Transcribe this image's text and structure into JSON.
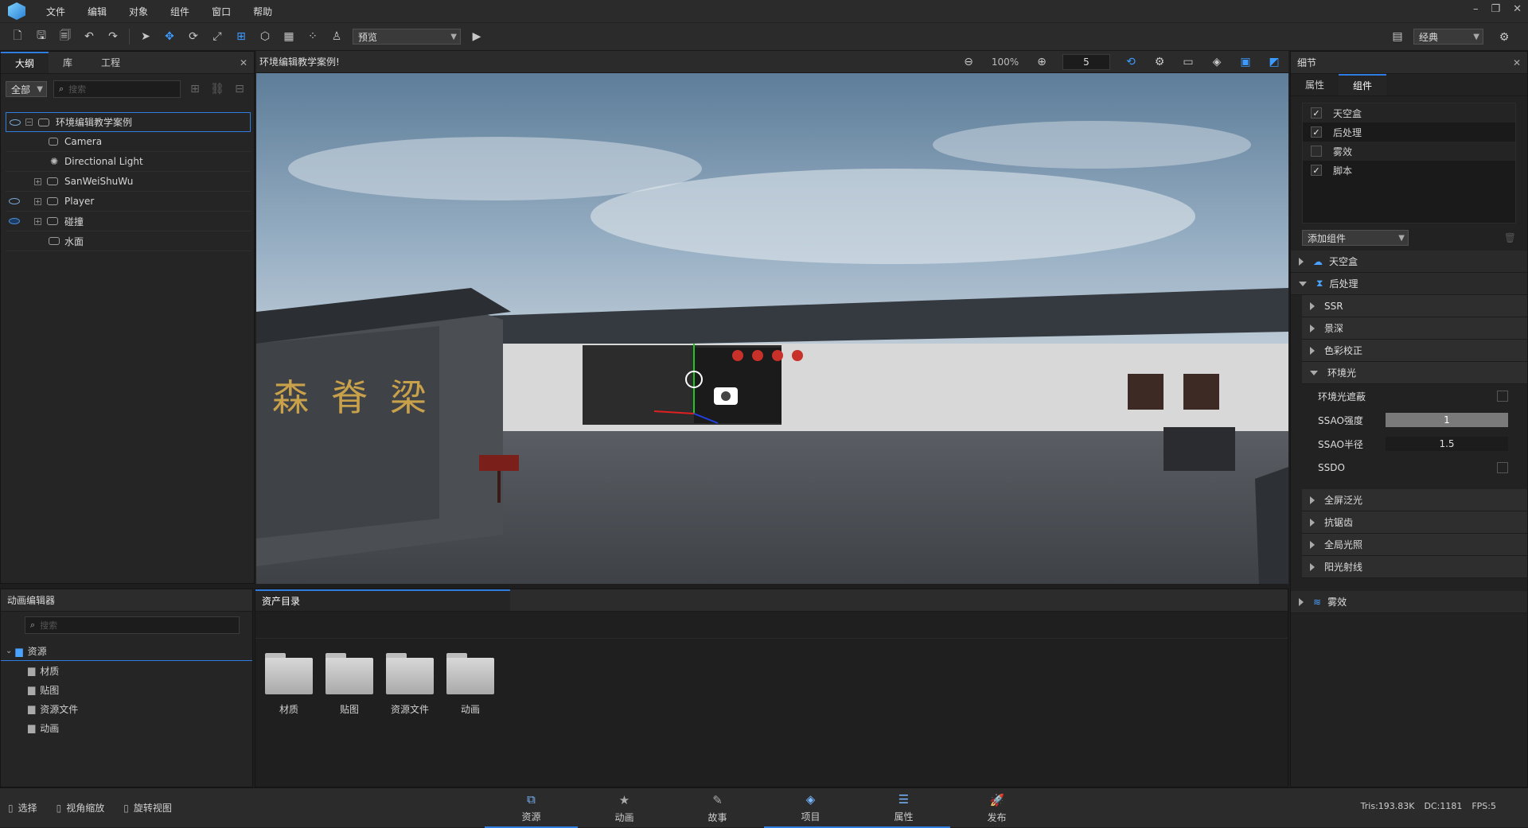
{
  "menu": [
    "文件",
    "编辑",
    "对象",
    "组件",
    "窗口",
    "帮助"
  ],
  "toolbar": {
    "preview_combo": "预览",
    "layout_combo": "经典"
  },
  "outline": {
    "tabs": [
      "大纲",
      "库",
      "工程"
    ],
    "filter": "全部",
    "search_placeholder": "搜索",
    "nodes": [
      "环境编辑教学案例",
      "Camera",
      "Directional Light",
      "SanWeiShuWu",
      "Player",
      "碰撞",
      "水面"
    ]
  },
  "viewport": {
    "title": "环境编辑教学案例!",
    "zoom": "100%",
    "speed": "5",
    "wall_text": "森脊梁"
  },
  "details": {
    "title": "细节",
    "tabs": [
      "属性",
      "组件"
    ],
    "components": [
      {
        "label": "天空盒",
        "checked": "✓"
      },
      {
        "label": "后处理",
        "checked": "✓"
      },
      {
        "label": "雾效",
        "checked": ""
      },
      {
        "label": "脚本",
        "checked": "✓"
      }
    ],
    "add_component": "添加组件",
    "sections": {
      "skybox": "天空盒",
      "postprocess": "后处理",
      "ssr": "SSR",
      "dof": "景深",
      "color": "色彩校正",
      "ambient": "环境光",
      "ao": "环境光遮蔽",
      "ssao_strength_label": "SSAO强度",
      "ssao_strength": "1",
      "ssao_radius_label": "SSAO半径",
      "ssao_radius": "1.5",
      "ssdo": "SSDO",
      "bloom": "全屏泛光",
      "aa": "抗锯齿",
      "gi": "全局光照",
      "sunray": "阳光射线",
      "fog": "雾效"
    }
  },
  "anim_editor": {
    "title": "动画编辑器",
    "search_placeholder": "搜索",
    "root": "资源",
    "children": [
      "材质",
      "贴图",
      "资源文件",
      "动画"
    ]
  },
  "assets": {
    "tab": "资产目录",
    "folders": [
      "材质",
      "贴图",
      "资源文件",
      "动画"
    ]
  },
  "status": {
    "left": [
      "选择",
      "视角缩放",
      "旋转视图"
    ],
    "nav": [
      "资源",
      "动画",
      "故事",
      "项目",
      "属性",
      "发布"
    ],
    "tris": "Tris:193.83K",
    "dc": "DC:1181",
    "fps": "FPS:5"
  }
}
